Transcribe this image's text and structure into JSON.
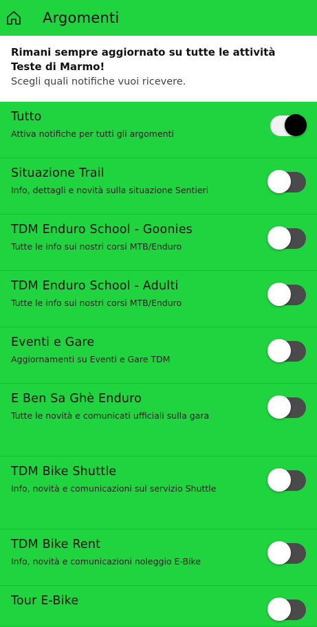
{
  "appbar": {
    "title": "Argomenti",
    "icon": "home-icon"
  },
  "intro": {
    "title": "Rimani sempre aggiornato su tutte le attività Teste di Marmo!",
    "subtitle": "Scegli quali notifiche vuoi ricevere."
  },
  "colors": {
    "background": "#1fd43e",
    "toggle_off_track": "#4a4a4a",
    "toggle_on_thumb": "#000000"
  },
  "topics": [
    {
      "title": "Tutto",
      "subtitle": "Attiva notifiche per tutti gli argomenti",
      "enabled": true
    },
    {
      "title": "Situazione Trail",
      "subtitle": "Info, dettagli e novità sulla situazione Sentieri",
      "enabled": false
    },
    {
      "title": "TDM Enduro School - Goonies",
      "subtitle": "Tutte le info sui nostri corsi MTB/Enduro",
      "enabled": false
    },
    {
      "title": "TDM Enduro School - Adulti",
      "subtitle": "Tutte le info sui nostri corsi MTB/Enduro",
      "enabled": false
    },
    {
      "title": "Eventi e Gare",
      "subtitle": "Aggiornamenti su Eventi e Gare TDM",
      "enabled": false
    },
    {
      "title": "E Ben Sa Ghè Enduro",
      "subtitle": "Tutte le novità e comunicati ufficiali sulla gara",
      "enabled": false
    },
    {
      "title": "TDM Bike Shuttle",
      "subtitle": "Info, novità e comunicazioni sul servizio Shuttle",
      "enabled": false
    },
    {
      "title": "TDM Bike Rent",
      "subtitle": "Info, novità e comunicazioni noleggio E-Bike",
      "enabled": false
    },
    {
      "title": "Tour E-Bike",
      "subtitle": "",
      "enabled": false
    }
  ]
}
